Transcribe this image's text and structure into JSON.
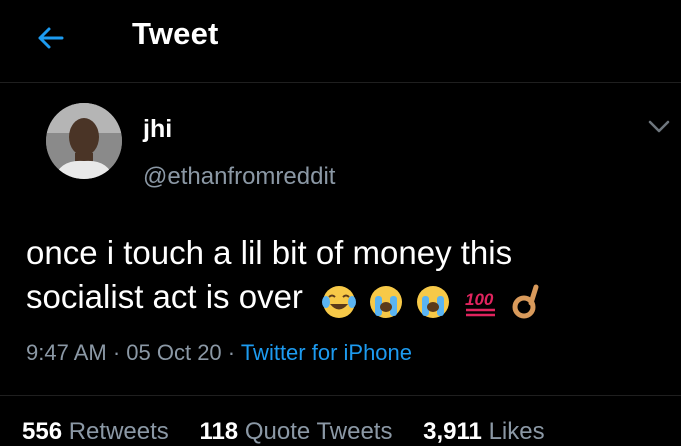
{
  "header": {
    "title": "Tweet",
    "back_icon": "arrow-left-icon"
  },
  "author": {
    "display_name": "jhi",
    "handle": "@ethanfromreddit"
  },
  "tweet": {
    "line1": "once i touch a lil bit of money this",
    "line2": "socialist act is over",
    "emojis": [
      "joy-emoji",
      "loudly-crying-emoji",
      "loudly-crying-emoji",
      "hundred-points-emoji",
      "ok-hand-emoji"
    ]
  },
  "meta": {
    "time": "9:47 AM",
    "sep1": " · ",
    "date": "05 Oct 20",
    "sep2": " · ",
    "source": "Twitter for iPhone"
  },
  "stats": {
    "retweets_count": "556",
    "retweets_label": "Retweets",
    "quotes_count": "118",
    "quotes_label": "Quote Tweets",
    "likes_count": "3,911",
    "likes_label": "Likes"
  },
  "colors": {
    "accent": "#1d9bf0",
    "muted": "#8b98a5",
    "background": "#000000"
  }
}
